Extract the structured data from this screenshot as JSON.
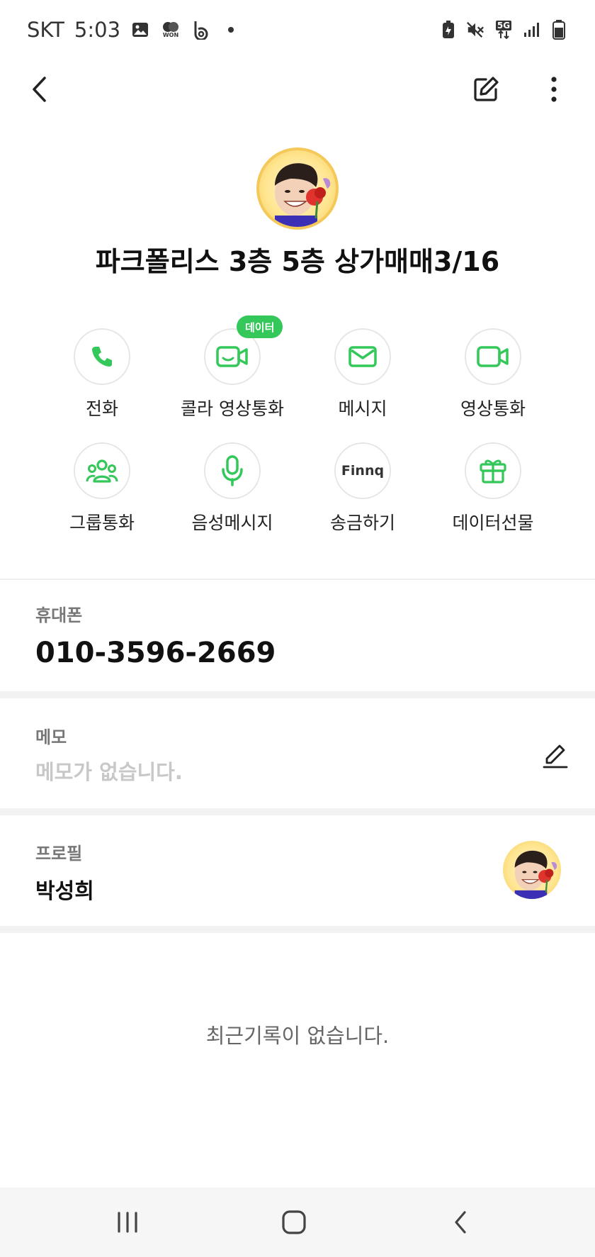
{
  "status_bar": {
    "carrier": "SKT",
    "time": "5:03",
    "left_icons": [
      "gallery-icon",
      "won-icon",
      "b-app-icon",
      "dot-icon"
    ],
    "right_icons": [
      "battery-saver-icon",
      "mute-icon",
      "5g-icon",
      "signal-icon",
      "battery-icon"
    ],
    "won_text": "WON",
    "network": "5G"
  },
  "top_bar": {
    "back_icon": "back-arrow-icon",
    "edit_icon": "edit-icon",
    "more_icon": "more-vertical-icon"
  },
  "contact": {
    "name": "파크폴리스  3층 5층 상가매매3/16"
  },
  "actions": {
    "badge": "데이터",
    "items": [
      {
        "label": "전화",
        "icon": "phone-icon"
      },
      {
        "label": "콜라 영상통화",
        "icon": "colla-video-icon"
      },
      {
        "label": "메시지",
        "icon": "message-icon"
      },
      {
        "label": "영상통화",
        "icon": "video-call-icon"
      },
      {
        "label": "그룹통화",
        "icon": "group-call-icon"
      },
      {
        "label": "음성메시지",
        "icon": "microphone-icon"
      },
      {
        "label": "송금하기",
        "icon": "finnq-icon",
        "icon_text": "Finnq"
      },
      {
        "label": "데이터선물",
        "icon": "gift-icon"
      }
    ]
  },
  "phone": {
    "label": "휴대폰",
    "number": "010-3596-2669"
  },
  "memo": {
    "label": "메모",
    "placeholder": "메모가 없습니다."
  },
  "profile": {
    "label": "프로필",
    "name": "박성희"
  },
  "history": {
    "empty_text": "최근기록이 없습니다."
  },
  "colors": {
    "accent": "#34c759",
    "divider": "#f2f2f2",
    "nav_bg": "#f6f6f6"
  }
}
